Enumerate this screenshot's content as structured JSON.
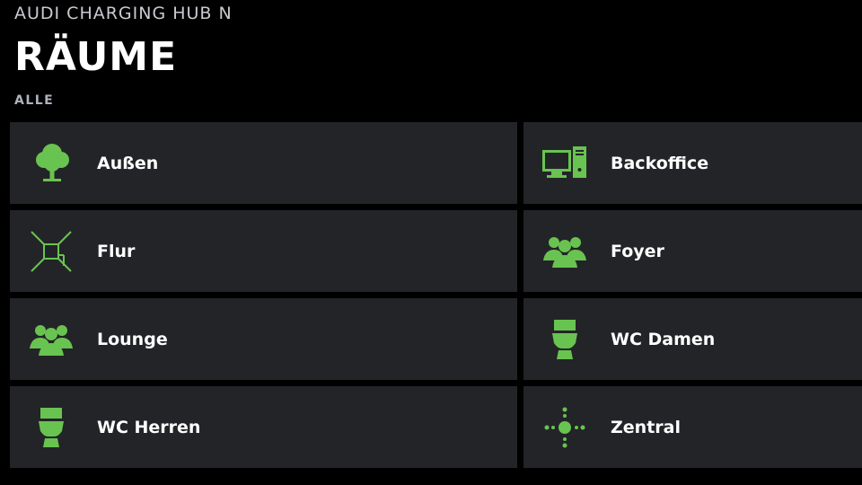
{
  "header": {
    "hub_name": "AUDI CHARGING HUB N",
    "title": "RÄUME",
    "filter": "ALLE"
  },
  "colors": {
    "accent": "#69c350",
    "tile_bg": "#232428",
    "background": "#000000"
  },
  "rooms": [
    {
      "label": "Außen",
      "icon": "tree-icon"
    },
    {
      "label": "Backoffice",
      "icon": "computer-icon"
    },
    {
      "label": "Flur",
      "icon": "hallway-icon"
    },
    {
      "label": "Foyer",
      "icon": "group-icon"
    },
    {
      "label": "Lounge",
      "icon": "group-icon"
    },
    {
      "label": "WC Damen",
      "icon": "toilet-icon"
    },
    {
      "label": "WC Herren",
      "icon": "toilet-icon"
    },
    {
      "label": "Zentral",
      "icon": "central-icon"
    }
  ]
}
